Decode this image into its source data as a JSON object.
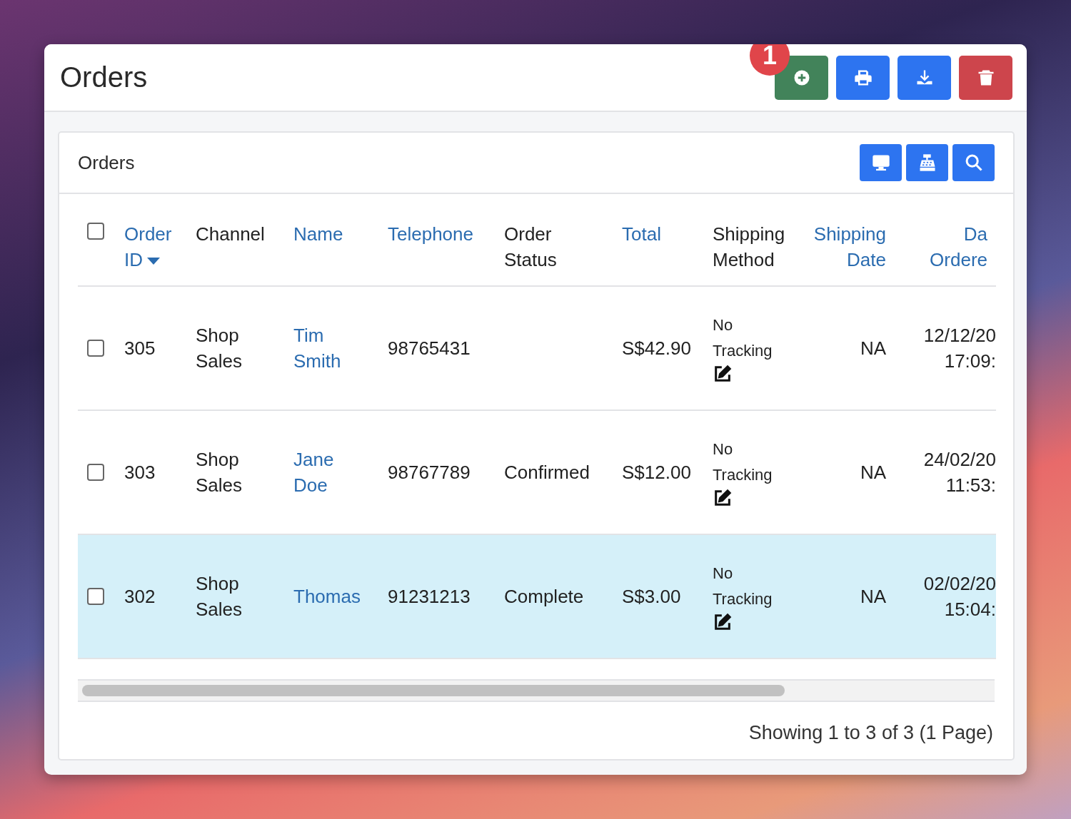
{
  "page": {
    "title": "Orders",
    "badge": "1",
    "actions": [
      {
        "kind": "add"
      },
      {
        "kind": "print"
      },
      {
        "kind": "download"
      },
      {
        "kind": "delete"
      }
    ]
  },
  "panel": {
    "title": "Orders",
    "tools": [
      {
        "kind": "monitor"
      },
      {
        "kind": "register"
      },
      {
        "kind": "search"
      }
    ]
  },
  "table": {
    "select_all": {
      "checked": false
    },
    "columns": [
      {
        "label": "Order ID",
        "sortable": true,
        "sorted": true
      },
      {
        "label": "Channel",
        "sortable": false,
        "sorted": false
      },
      {
        "label": "Name",
        "sortable": true,
        "sorted": false
      },
      {
        "label": "Telephone",
        "sortable": true,
        "sorted": false
      },
      {
        "label": "Order Status",
        "sortable": false,
        "sorted": false
      },
      {
        "label": "Total",
        "sortable": true,
        "sorted": false
      },
      {
        "label": "Shipping Method",
        "sortable": false,
        "sorted": false
      },
      {
        "label": "Shipping Date",
        "sortable": true,
        "sorted": false
      },
      {
        "label": "Da Ordere",
        "sortable": true,
        "sorted": false
      }
    ],
    "rows": [
      {
        "checked": false,
        "selected": false,
        "order_id": "305",
        "channel": "Shop Sales",
        "name": "Tim Smith",
        "telephone": "98765431",
        "total": "S$42.90",
        "shipping_method": "No Tracking",
        "shipping_date": "NA",
        "date_ordered": [
          "12/12/20",
          "17:09:"
        ]
      },
      {
        "checked": false,
        "selected": false,
        "order_id": "303",
        "channel": "Shop Sales",
        "name": "Jane Doe",
        "telephone": "98767789",
        "status": "Confirmed",
        "total": "S$12.00",
        "shipping_method": "No Tracking",
        "shipping_date": "NA",
        "date_ordered": [
          "24/02/20",
          "11:53:"
        ]
      },
      {
        "checked": false,
        "selected": true,
        "order_id": "302",
        "channel": "Shop Sales",
        "name": "Thomas",
        "telephone": "91231213",
        "status": "Complete",
        "total": "S$3.00",
        "shipping_method": "No Tracking",
        "shipping_date": "NA",
        "date_ordered": [
          "02/02/20",
          "15:04:"
        ]
      }
    ]
  },
  "footer": "Showing 1 to 3 of 3 (1 Page)"
}
